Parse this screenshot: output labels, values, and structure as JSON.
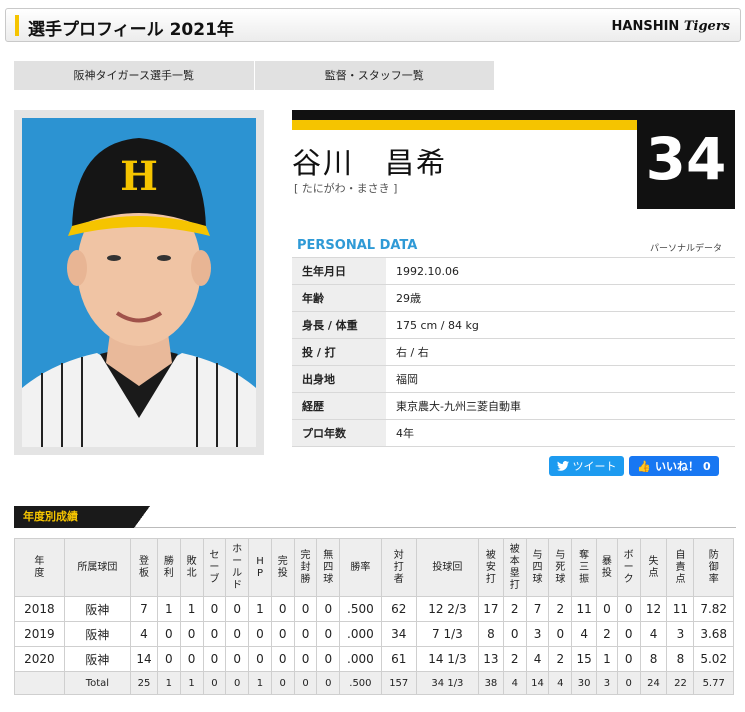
{
  "header": {
    "title": "選手プロフィール 2021年",
    "logo_main": "HANSHIN",
    "logo_sub": "Tigers"
  },
  "nav": {
    "roster": "阪神タイガース選手一覧",
    "staff": "監督・スタッフ一覧"
  },
  "player": {
    "number": "34",
    "name": "谷川　昌希",
    "kana": "[ たにがわ・まさき ]"
  },
  "personal": {
    "title": "PERSONAL DATA",
    "subtitle": "パーソナルデータ",
    "rows": [
      {
        "label": "生年月日",
        "value": "1992.10.06"
      },
      {
        "label": "年齢",
        "value": "29歳"
      },
      {
        "label": "身長 / 体重",
        "value": "175 cm / 84 kg"
      },
      {
        "label": "投 / 打",
        "value": "右 / 右"
      },
      {
        "label": "出身地",
        "value": "福岡"
      },
      {
        "label": "経歴",
        "value": "東京農大-九州三菱自動車"
      },
      {
        "label": "プロ年数",
        "value": "4年"
      }
    ]
  },
  "social": {
    "tweet": "ツイート",
    "like": "いいね！",
    "like_count": "0"
  },
  "stats": {
    "section_title": "年度別成績",
    "headers": [
      "年度",
      "所属球団",
      "登板",
      "勝利",
      "敗北",
      "セーブ",
      "ホールド",
      "HP",
      "完投",
      "完封勝",
      "無四球",
      "勝率",
      "対打者",
      "投球回",
      "被安打",
      "被本塁打",
      "与四球",
      "与死球",
      "奪三振",
      "暴投",
      "ボーク",
      "失点",
      "自責点",
      "防御率"
    ],
    "rows": [
      [
        "2018",
        "阪神",
        "7",
        "1",
        "1",
        "0",
        "0",
        "1",
        "0",
        "0",
        "0",
        ".500",
        "62",
        "12 2/3",
        "17",
        "2",
        "7",
        "2",
        "11",
        "0",
        "0",
        "12",
        "11",
        "7.82"
      ],
      [
        "2019",
        "阪神",
        "4",
        "0",
        "0",
        "0",
        "0",
        "0",
        "0",
        "0",
        "0",
        ".000",
        "34",
        "7 1/3",
        "8",
        "0",
        "3",
        "0",
        "4",
        "2",
        "0",
        "4",
        "3",
        "3.68"
      ],
      [
        "2020",
        "阪神",
        "14",
        "0",
        "0",
        "0",
        "0",
        "0",
        "0",
        "0",
        "0",
        ".000",
        "61",
        "14 1/3",
        "13",
        "2",
        "4",
        "2",
        "15",
        "1",
        "0",
        "8",
        "8",
        "5.02"
      ]
    ],
    "total": [
      "",
      "Total",
      "25",
      "1",
      "1",
      "0",
      "0",
      "1",
      "0",
      "0",
      "0",
      ".500",
      "157",
      "34 1/3",
      "38",
      "4",
      "14",
      "4",
      "30",
      "3",
      "0",
      "24",
      "22",
      "5.77"
    ]
  }
}
